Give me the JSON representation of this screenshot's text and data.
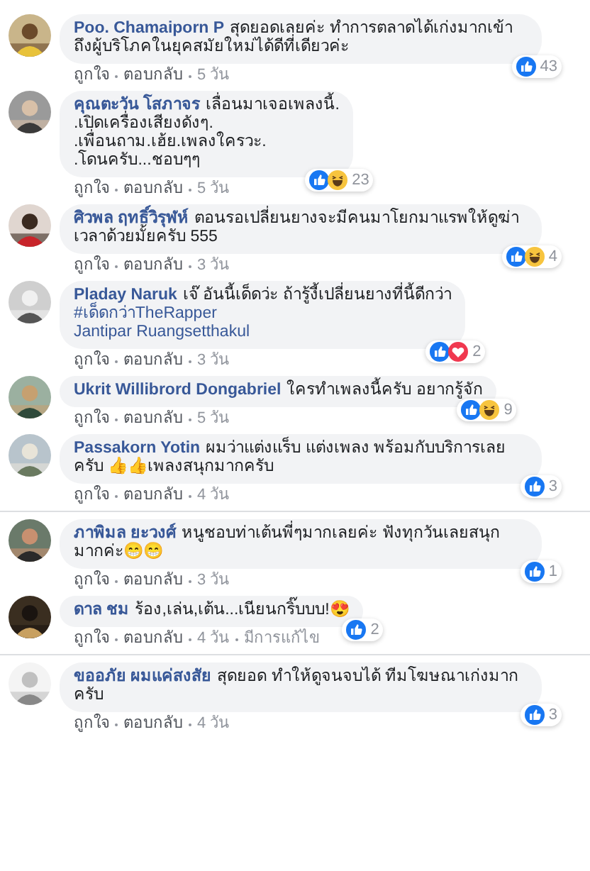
{
  "comments": [
    {
      "name": "Poo. Chamaiporn P",
      "lines": [
        {
          "kind": "text",
          "text": "สุดยอดเลยค่ะ ทำการตลาดได้เก่งมากเข้าถึงผู้บริโภคในยุคสมัยใหม่ได้ดีที่เดียวค่ะ"
        }
      ],
      "reactions": [
        {
          "kind": "like"
        }
      ],
      "count": "43",
      "actions": [
        "ถูกใจ",
        "ตอบกลับ",
        "5 วัน"
      ],
      "thread_start": false
    },
    {
      "name": "คุณตะวัน โสภาจร",
      "lines": [
        {
          "kind": "text",
          "text": "เลื่อนมาเจอเพลงนี้.\n.เปิดเครื่องเสียงดังๆ.\n.เพื่อนถาม.เฮ้ย.เพลงใครวะ.\n.โดนครับ...ชอบๆๆ"
        }
      ],
      "reactions": [
        {
          "kind": "like"
        },
        {
          "kind": "haha"
        }
      ],
      "count": "23",
      "actions": [
        "ถูกใจ",
        "ตอบกลับ",
        "5 วัน"
      ],
      "thread_start": false
    },
    {
      "name": "ศิวพล ฤทธิ์วิรุฬห์",
      "lines": [
        {
          "kind": "text",
          "text": "ตอนรอเปลี่ยนยางจะมีคนมาโยกมาแรพให้ดูฆ่าเวลาด้วยมั้ยครับ 555"
        }
      ],
      "reactions": [
        {
          "kind": "like"
        },
        {
          "kind": "haha"
        }
      ],
      "count": "4",
      "actions": [
        "ถูกใจ",
        "ตอบกลับ",
        "3 วัน"
      ],
      "thread_start": false
    },
    {
      "name": "Pladay Naruk",
      "lines": [
        {
          "kind": "text",
          "text": "เจ๊ อันนี้เด็ดว่ะ ถ้ารู้งี้เปลี่ยนยางที่นี้ดีกว่า"
        },
        {
          "kind": "hashtag",
          "text": "#เด็ดกว่าTheRapper"
        },
        {
          "kind": "mention",
          "text": "Jantipar Ruangsetthakul"
        }
      ],
      "reactions": [
        {
          "kind": "like"
        },
        {
          "kind": "love"
        }
      ],
      "count": "2",
      "actions": [
        "ถูกใจ",
        "ตอบกลับ",
        "3 วัน"
      ],
      "thread_start": false
    },
    {
      "name": "Ukrit Willibrord Dongabriel",
      "lines": [
        {
          "kind": "text",
          "text": "ใครทำเพลงนี้ครับ อยากรู้จัก"
        }
      ],
      "reactions": [
        {
          "kind": "like"
        },
        {
          "kind": "haha"
        }
      ],
      "count": "9",
      "actions": [
        "ถูกใจ",
        "ตอบกลับ",
        "5 วัน"
      ],
      "thread_start": false
    },
    {
      "name": "Passakorn Yotin",
      "lines": [
        {
          "kind": "text",
          "text": "ผมว่าแต่งแร็บ แต่งเพลง พร้อมกับบริการเลยครับ 👍👍เพลงสนุกมากครับ"
        }
      ],
      "reactions": [
        {
          "kind": "like"
        }
      ],
      "count": "3",
      "actions": [
        "ถูกใจ",
        "ตอบกลับ",
        "4 วัน"
      ],
      "thread_start": false
    },
    {
      "name": "ภาพิมล ยะวงศ์",
      "lines": [
        {
          "kind": "text",
          "text": "หนูชอบท่าเต้นพี่ๆมากเลยค่ะ ฟังทุกวันเลยสนุกมากค่ะ😁😁"
        }
      ],
      "reactions": [
        {
          "kind": "like"
        }
      ],
      "count": "1",
      "actions": [
        "ถูกใจ",
        "ตอบกลับ",
        "3 วัน"
      ],
      "thread_start": true
    },
    {
      "name": "ดาล ชม",
      "lines": [
        {
          "kind": "text",
          "text": "ร้อง,เล่น,เต้น...เนียนกริ๊บบบ!😍"
        }
      ],
      "reactions": [
        {
          "kind": "like"
        }
      ],
      "count": "2",
      "actions": [
        "ถูกใจ",
        "ตอบกลับ",
        "4 วัน",
        "มีการแก้ไข"
      ],
      "thread_start": false
    },
    {
      "name": "ขออภัย ผมแค่สงสัย",
      "lines": [
        {
          "kind": "text",
          "text": "สุดยอด ทำให้ดูจนจบได้ ทีมโฆษณาเก่งมากครับ"
        }
      ],
      "reactions": [
        {
          "kind": "like"
        }
      ],
      "count": "3",
      "actions": [
        "ถูกใจ",
        "ตอบกลับ",
        "4 วัน"
      ],
      "thread_start": true
    }
  ]
}
